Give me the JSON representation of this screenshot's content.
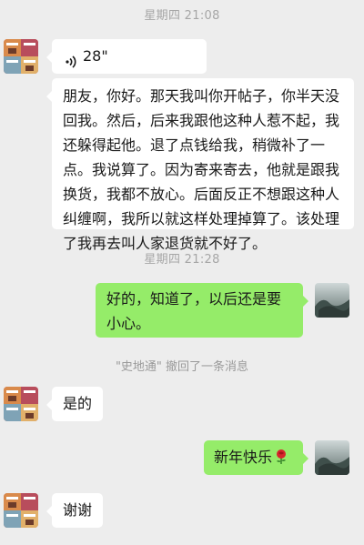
{
  "chat": {
    "time1": "星期四 21:08",
    "voice_duration": "28\"",
    "msg_long": "朋友，你好。那天我叫你开帖子，你半天没回我。然后，后来我跟他这种人惹不起，我还躲得起他。退了点钱给我，稍微补了一点。我说算了。因为寄来寄去，他就是跟我换货，我都不放心。后面反正不想跟这种人纠缠啊，我所以就这样处理掉算了。该处理了我再去叫人家退货就不好了。",
    "time2": "星期四 21:28",
    "msg_reply": "好的，知道了，以后还是要小心。",
    "recall_notice": "\"史地通\" 撤回了一条消息",
    "msg_yes": "是的",
    "msg_newyear": "新年快乐",
    "msg_thanks": "谢谢"
  },
  "icons": {
    "voice": "voice-wave-icon",
    "rose": "rose-emoji-icon",
    "contact_avatar": "contact-avatar",
    "self_avatar": "self-avatar"
  },
  "colors": {
    "background": "#ededed",
    "incoming_bubble": "#ffffff",
    "outgoing_bubble": "#95ec69",
    "timestamp": "#a6a6a6"
  }
}
